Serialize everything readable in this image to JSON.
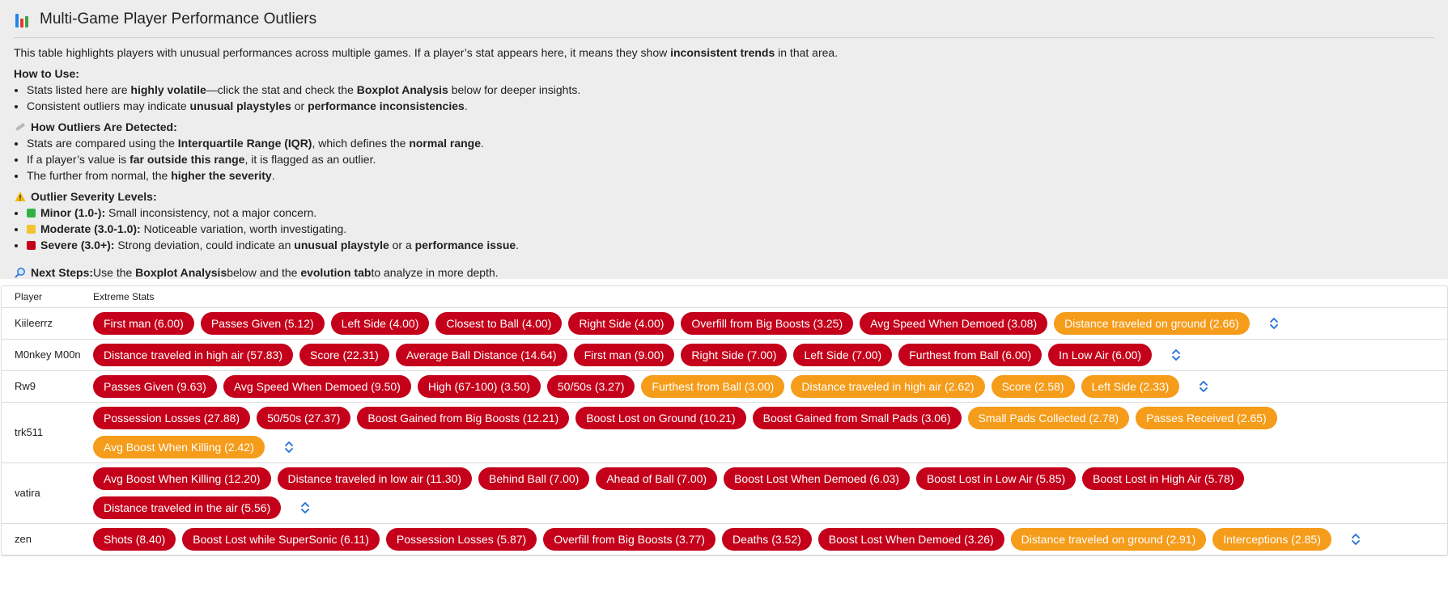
{
  "header": {
    "title": "Multi-Game Player Performance Outliers",
    "intro_1": "This table highlights players with unusual performances across multiple games. If a player’s stat appears here, it means they show ",
    "intro_bold": "inconsistent trends",
    "intro_2": " in that area."
  },
  "how_to_use": {
    "heading": "How to Use:",
    "b1_a": "Stats listed here are ",
    "b1_bold1": "highly volatile",
    "b1_b": "—click the stat and check the ",
    "b1_bold2": "Boxplot Analysis",
    "b1_c": " below for deeper insights.",
    "b2_a": "Consistent outliers may indicate ",
    "b2_bold1": "unusual playstyles",
    "b2_b": " or ",
    "b2_bold2": "performance inconsistencies",
    "b2_c": "."
  },
  "detection": {
    "heading": "How Outliers Are Detected:",
    "b1_a": "Stats are compared using the ",
    "b1_bold1": "Interquartile Range (IQR)",
    "b1_b": ", which defines the ",
    "b1_bold2": "normal range",
    "b1_c": ".",
    "b2_a": "If a player’s value is ",
    "b2_bold": "far outside this range",
    "b2_b": ", it is flagged as an outlier.",
    "b3_a": "The further from normal, the ",
    "b3_bold": "higher the severity",
    "b3_b": "."
  },
  "severity": {
    "heading": "Outlier Severity Levels:",
    "minor_label": "Minor (1.0-):",
    "minor_text": " Small inconsistency, not a major concern.",
    "moderate_label": "Moderate (3.0-1.0):",
    "moderate_text": " Noticeable variation, worth investigating.",
    "severe_label": "Severe (3.0+):",
    "severe_text_a": " Strong deviation, could indicate an ",
    "severe_bold1": "unusual playstyle",
    "severe_text_b": " or a ",
    "severe_bold2": "performance issue",
    "severe_text_c": "."
  },
  "next_steps": {
    "label": "Next Steps:",
    "a": " Use the ",
    "bold1": "Boxplot Analysis",
    "b": " below and the ",
    "bold2": "evolution tab",
    "c": " to analyze in more depth."
  },
  "colors": {
    "severe": "#c4001a",
    "moderate": "#f59c1a",
    "minor": "#2fb344",
    "moderate_square": "#f2c230",
    "expand_icon": "#1e6fd9"
  },
  "table": {
    "col_player": "Player",
    "col_stats": "Extreme Stats",
    "rows": [
      {
        "player": "Kiileerrz",
        "stats": [
          {
            "label": "First man (6.00)",
            "level": "severe"
          },
          {
            "label": "Passes Given (5.12)",
            "level": "severe"
          },
          {
            "label": "Left Side (4.00)",
            "level": "severe"
          },
          {
            "label": "Closest to Ball (4.00)",
            "level": "severe"
          },
          {
            "label": "Right Side (4.00)",
            "level": "severe"
          },
          {
            "label": "Overfill from Big Boosts (3.25)",
            "level": "severe"
          },
          {
            "label": "Avg Speed When Demoed (3.08)",
            "level": "severe"
          },
          {
            "label": "Distance traveled on ground (2.66)",
            "level": "moderate"
          }
        ]
      },
      {
        "player": "M0nkey M00n",
        "stats": [
          {
            "label": "Distance traveled in high air (57.83)",
            "level": "severe"
          },
          {
            "label": "Score (22.31)",
            "level": "severe"
          },
          {
            "label": "Average Ball Distance (14.64)",
            "level": "severe"
          },
          {
            "label": "First man (9.00)",
            "level": "severe"
          },
          {
            "label": "Right Side (7.00)",
            "level": "severe"
          },
          {
            "label": "Left Side (7.00)",
            "level": "severe"
          },
          {
            "label": "Furthest from Ball (6.00)",
            "level": "severe"
          },
          {
            "label": "In Low Air (6.00)",
            "level": "severe"
          }
        ]
      },
      {
        "player": "Rw9",
        "stats": [
          {
            "label": "Passes Given (9.63)",
            "level": "severe"
          },
          {
            "label": "Avg Speed When Demoed (9.50)",
            "level": "severe"
          },
          {
            "label": "High (67-100) (3.50)",
            "level": "severe"
          },
          {
            "label": "50/50s (3.27)",
            "level": "severe"
          },
          {
            "label": "Furthest from Ball (3.00)",
            "level": "moderate"
          },
          {
            "label": "Distance traveled in high air (2.62)",
            "level": "moderate"
          },
          {
            "label": "Score (2.58)",
            "level": "moderate"
          },
          {
            "label": "Left Side (2.33)",
            "level": "moderate"
          }
        ]
      },
      {
        "player": "trk511",
        "stats": [
          {
            "label": "Possession Losses (27.88)",
            "level": "severe"
          },
          {
            "label": "50/50s (27.37)",
            "level": "severe"
          },
          {
            "label": "Boost Gained from Big Boosts (12.21)",
            "level": "severe"
          },
          {
            "label": "Boost Lost on Ground (10.21)",
            "level": "severe"
          },
          {
            "label": "Boost Gained from Small Pads (3.06)",
            "level": "severe"
          },
          {
            "label": "Small Pads Collected (2.78)",
            "level": "moderate"
          },
          {
            "label": "Passes Received (2.65)",
            "level": "moderate"
          },
          {
            "label": "Avg Boost When Killing (2.42)",
            "level": "moderate"
          }
        ]
      },
      {
        "player": "vatira",
        "stats": [
          {
            "label": "Avg Boost When Killing (12.20)",
            "level": "severe"
          },
          {
            "label": "Distance traveled in low air (11.30)",
            "level": "severe"
          },
          {
            "label": "Behind Ball (7.00)",
            "level": "severe"
          },
          {
            "label": "Ahead of Ball (7.00)",
            "level": "severe"
          },
          {
            "label": "Boost Lost When Demoed (6.03)",
            "level": "severe"
          },
          {
            "label": "Boost Lost in Low Air (5.85)",
            "level": "severe"
          },
          {
            "label": "Boost Lost in High Air (5.78)",
            "level": "severe"
          },
          {
            "label": "Distance traveled in the air (5.56)",
            "level": "severe"
          }
        ]
      },
      {
        "player": "zen",
        "stats": [
          {
            "label": "Shots (8.40)",
            "level": "severe"
          },
          {
            "label": "Boost Lost while SuperSonic (6.11)",
            "level": "severe"
          },
          {
            "label": "Possession Losses (5.87)",
            "level": "severe"
          },
          {
            "label": "Overfill from Big Boosts (3.77)",
            "level": "severe"
          },
          {
            "label": "Deaths (3.52)",
            "level": "severe"
          },
          {
            "label": "Boost Lost When Demoed (3.26)",
            "level": "severe"
          },
          {
            "label": "Distance traveled on ground (2.91)",
            "level": "moderate"
          },
          {
            "label": "Interceptions (2.85)",
            "level": "moderate"
          }
        ]
      }
    ]
  }
}
